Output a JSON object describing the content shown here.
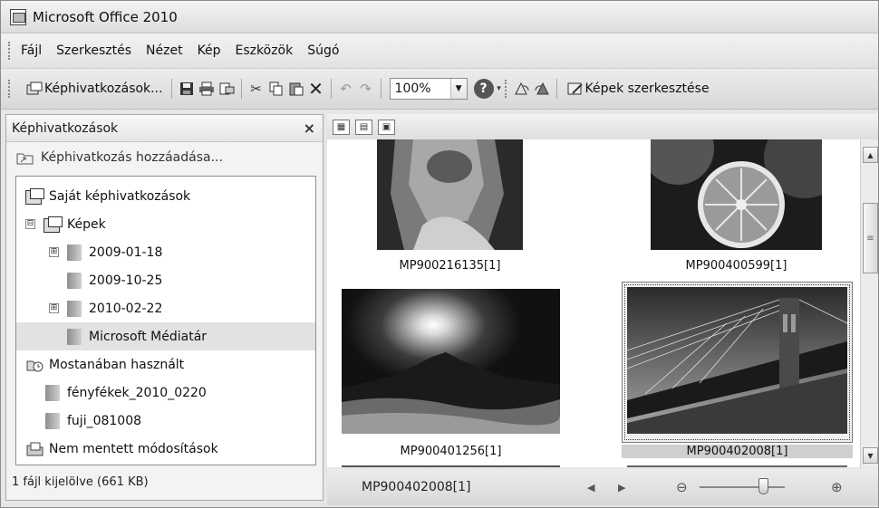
{
  "window": {
    "title": "Microsoft Office 2010"
  },
  "menu": [
    "Fájl",
    "Szerkesztés",
    "Nézet",
    "Kép",
    "Eszközök",
    "Súgó"
  ],
  "toolbar": {
    "shortcuts_label": "Képhivatkozások...",
    "zoom_value": "100%",
    "help_glyph": "?",
    "edit_label": "Képek szerkesztése"
  },
  "task_pane": {
    "title": "Képhivatkozások",
    "close_glyph": "×",
    "add_link_label": "Képhivatkozás hozzáadása...",
    "tree": [
      {
        "label": "Saját képhivatkozások",
        "level": 0,
        "icon": "collection-icon",
        "expander": ""
      },
      {
        "label": "Képek",
        "level": 1,
        "icon": "collection-icon",
        "expander": "⊟"
      },
      {
        "label": "2009-01-18",
        "level": 2,
        "icon": "folder-icon",
        "expander": "⊞"
      },
      {
        "label": "2009-10-25",
        "level": 2,
        "icon": "folder-icon",
        "expander": ""
      },
      {
        "label": "2010-02-22",
        "level": 2,
        "icon": "folder-icon",
        "expander": "⊞"
      },
      {
        "label": "Microsoft Médiatár",
        "level": 2,
        "icon": "folder-icon",
        "expander": "",
        "selected": true
      },
      {
        "label": "Mostanában használt",
        "level": 0,
        "icon": "recent-icon",
        "expander": ""
      },
      {
        "label": "fényfékek_2010_0220",
        "level": 1,
        "icon": "folder-icon",
        "expander": ""
      },
      {
        "label": "fuji_081008",
        "level": 1,
        "icon": "folder-icon",
        "expander": ""
      },
      {
        "label": "Nem mentett módosítások",
        "level": 0,
        "icon": "unsaved-icon",
        "expander": ""
      }
    ],
    "status": "1 fájl kijelölve (661 KB)"
  },
  "thumbnails": [
    {
      "name": "MP900216135[1]",
      "subject": "statue",
      "selected": false
    },
    {
      "name": "MP900400599[1]",
      "subject": "oranges",
      "selected": false
    },
    {
      "name": "MP900401256[1]",
      "subject": "mountain-sunrise",
      "selected": false
    },
    {
      "name": "MP900402008[1]",
      "subject": "bridge",
      "selected": true
    }
  ],
  "statusbar": {
    "current_file": "MP900402008[1]",
    "zoom_slider_level": 0.75
  },
  "colors": {
    "selection": "#cfcfcf",
    "chrome": "#e0e0e0"
  }
}
